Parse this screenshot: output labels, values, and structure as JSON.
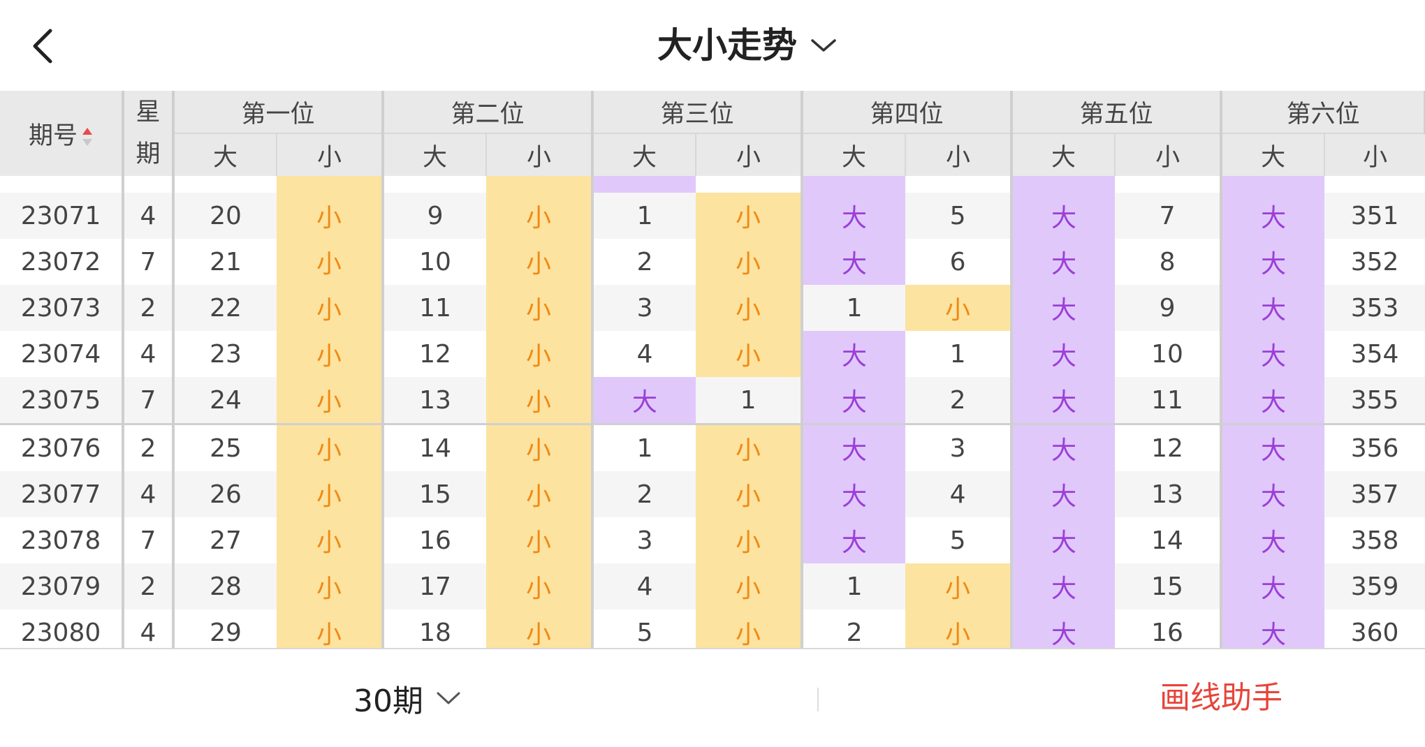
{
  "header": {
    "title": "大小走势",
    "back_icon": "chevron-left-icon",
    "title_dropdown_icon": "chevron-down-icon"
  },
  "table": {
    "head": {
      "period": "期号",
      "week": "星期",
      "positions": [
        "第一位",
        "第二位",
        "第三位",
        "第四位",
        "第五位",
        "第六位"
      ],
      "big": "大",
      "small": "小"
    },
    "rows": [
      {
        "period": "23071",
        "week": "4",
        "cells": [
          {
            "big": "20",
            "small": "小"
          },
          {
            "big": "9",
            "small": "小"
          },
          {
            "big": "1",
            "small": "小"
          },
          {
            "big": "大",
            "small": "5"
          },
          {
            "big": "大",
            "small": "7"
          },
          {
            "big": "大",
            "small": "351"
          }
        ]
      },
      {
        "period": "23072",
        "week": "7",
        "cells": [
          {
            "big": "21",
            "small": "小"
          },
          {
            "big": "10",
            "small": "小"
          },
          {
            "big": "2",
            "small": "小"
          },
          {
            "big": "大",
            "small": "6"
          },
          {
            "big": "大",
            "small": "8"
          },
          {
            "big": "大",
            "small": "352"
          }
        ]
      },
      {
        "period": "23073",
        "week": "2",
        "cells": [
          {
            "big": "22",
            "small": "小"
          },
          {
            "big": "11",
            "small": "小"
          },
          {
            "big": "3",
            "small": "小"
          },
          {
            "big": "1",
            "small": "小"
          },
          {
            "big": "大",
            "small": "9"
          },
          {
            "big": "大",
            "small": "353"
          }
        ]
      },
      {
        "period": "23074",
        "week": "4",
        "cells": [
          {
            "big": "23",
            "small": "小"
          },
          {
            "big": "12",
            "small": "小"
          },
          {
            "big": "4",
            "small": "小"
          },
          {
            "big": "大",
            "small": "1"
          },
          {
            "big": "大",
            "small": "10"
          },
          {
            "big": "大",
            "small": "354"
          }
        ]
      },
      {
        "period": "23075",
        "week": "7",
        "cells": [
          {
            "big": "24",
            "small": "小"
          },
          {
            "big": "13",
            "small": "小"
          },
          {
            "big": "大",
            "small": "1"
          },
          {
            "big": "大",
            "small": "2"
          },
          {
            "big": "大",
            "small": "11"
          },
          {
            "big": "大",
            "small": "355"
          }
        ]
      },
      {
        "period": "23076",
        "week": "2",
        "cells": [
          {
            "big": "25",
            "small": "小"
          },
          {
            "big": "14",
            "small": "小"
          },
          {
            "big": "1",
            "small": "小"
          },
          {
            "big": "大",
            "small": "3"
          },
          {
            "big": "大",
            "small": "12"
          },
          {
            "big": "大",
            "small": "356"
          }
        ]
      },
      {
        "period": "23077",
        "week": "4",
        "cells": [
          {
            "big": "26",
            "small": "小"
          },
          {
            "big": "15",
            "small": "小"
          },
          {
            "big": "2",
            "small": "小"
          },
          {
            "big": "大",
            "small": "4"
          },
          {
            "big": "大",
            "small": "13"
          },
          {
            "big": "大",
            "small": "357"
          }
        ]
      },
      {
        "period": "23078",
        "week": "7",
        "cells": [
          {
            "big": "27",
            "small": "小"
          },
          {
            "big": "16",
            "small": "小"
          },
          {
            "big": "3",
            "small": "小"
          },
          {
            "big": "大",
            "small": "5"
          },
          {
            "big": "大",
            "small": "14"
          },
          {
            "big": "大",
            "small": "358"
          }
        ]
      },
      {
        "period": "23079",
        "week": "2",
        "cells": [
          {
            "big": "28",
            "small": "小"
          },
          {
            "big": "17",
            "small": "小"
          },
          {
            "big": "4",
            "small": "小"
          },
          {
            "big": "1",
            "small": "小"
          },
          {
            "big": "大",
            "small": "15"
          },
          {
            "big": "大",
            "small": "359"
          }
        ]
      },
      {
        "period": "23080",
        "week": "4",
        "cells": [
          {
            "big": "29",
            "small": "小"
          },
          {
            "big": "18",
            "small": "小"
          },
          {
            "big": "5",
            "small": "小"
          },
          {
            "big": "2",
            "small": "小"
          },
          {
            "big": "大",
            "small": "16"
          },
          {
            "big": "大",
            "small": "360"
          }
        ]
      }
    ]
  },
  "footer": {
    "period_count": "30期",
    "period_dropdown_icon": "chevron-down-icon",
    "draw_helper": "画线助手"
  },
  "colors": {
    "big_highlight_bg": "#e0c8fb",
    "big_highlight_text": "#9b3fd6",
    "small_highlight_bg": "#fde3a0",
    "small_highlight_text": "#f08a14",
    "draw_helper_text": "#e6453a",
    "sort_arrow": "#e84a4a"
  }
}
